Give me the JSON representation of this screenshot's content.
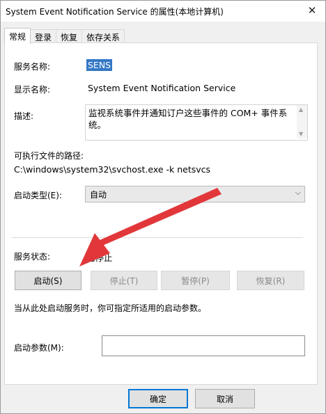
{
  "window": {
    "title": "System Event Notification Service 的属性(本地计算机)",
    "close_glyph": "✕"
  },
  "tabs": [
    {
      "label": "常规",
      "active": true
    },
    {
      "label": "登录",
      "active": false
    },
    {
      "label": "恢复",
      "active": false
    },
    {
      "label": "依存关系",
      "active": false
    }
  ],
  "general": {
    "service_name_label": "服务名称:",
    "service_name": "SENS",
    "display_name_label": "显示名称:",
    "display_name": "System Event Notification Service",
    "description_label": "描述:",
    "description": "监视系统事件并通知订户这些事件的 COM+ 事件系统。",
    "exe_path_label": "可执行文件的路径:",
    "exe_path": "C:\\windows\\system32\\svchost.exe -k netsvcs",
    "startup_type_label": "启动类型(E):",
    "startup_type": "自动",
    "status_label": "服务状态:",
    "status": "已停止",
    "buttons": {
      "start": "启动(S)",
      "stop": "停止(T)",
      "pause": "暂停(P)",
      "resume": "恢复(R)"
    },
    "hint": "当从此处启动服务时，你可指定所适用的启动参数。",
    "params_label": "启动参数(M):",
    "params_value": ""
  },
  "footer": {
    "ok": "确定",
    "cancel": "取消"
  },
  "annotation": {
    "arrow_color": "#e2373a"
  }
}
